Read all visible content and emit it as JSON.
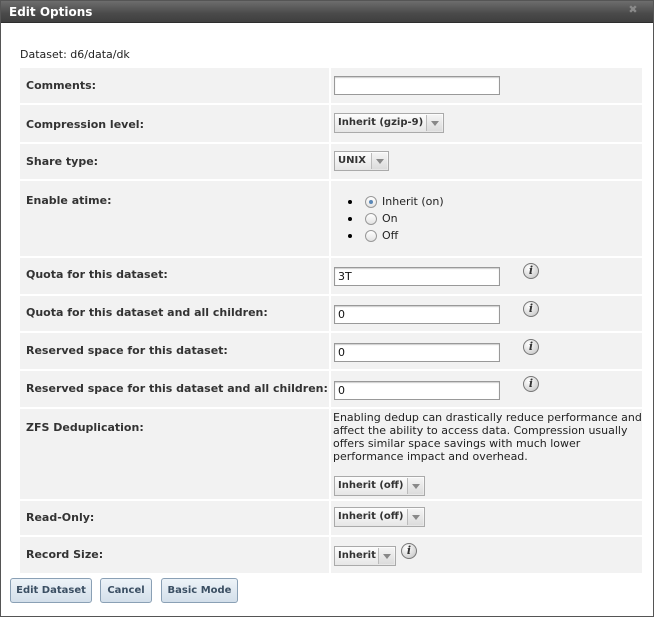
{
  "dialog": {
    "title": "Edit Options",
    "close_icon": "close-icon"
  },
  "dataset_label": "Dataset: d6/data/dk",
  "fields": {
    "comments": {
      "label": "Comments:",
      "value": ""
    },
    "compression": {
      "label": "Compression level:",
      "value": "Inherit (gzip-9)"
    },
    "share_type": {
      "label": "Share type:",
      "value": "UNIX"
    },
    "atime": {
      "label": "Enable atime:",
      "options": [
        "Inherit (on)",
        "On",
        "Off"
      ],
      "selected": "Inherit (on)"
    },
    "quota": {
      "label": "Quota for this dataset:",
      "value": "3T"
    },
    "quota_children": {
      "label": "Quota for this dataset and all children:",
      "value": "0"
    },
    "reserved": {
      "label": "Reserved space for this dataset:",
      "value": "0"
    },
    "reserved_children": {
      "label": "Reserved space for this dataset and all children:",
      "value": "0"
    },
    "dedup": {
      "label": "ZFS Deduplication:",
      "note": "Enabling dedup can drastically reduce performance and affect the ability to access data. Compression usually offers similar space savings with much lower performance impact and overhead.",
      "value": "Inherit (off)"
    },
    "readonly": {
      "label": "Read-Only:",
      "value": "Inherit (off)"
    },
    "record_size": {
      "label": "Record Size:",
      "value": "Inherit"
    }
  },
  "buttons": {
    "edit": "Edit Dataset",
    "cancel": "Cancel",
    "basic": "Basic Mode"
  },
  "info_icon_glyph": "i",
  "colors": {
    "row_background": "#f2f2f2",
    "titlebar": "#4a4a4a",
    "button_text": "#3b4f63"
  }
}
